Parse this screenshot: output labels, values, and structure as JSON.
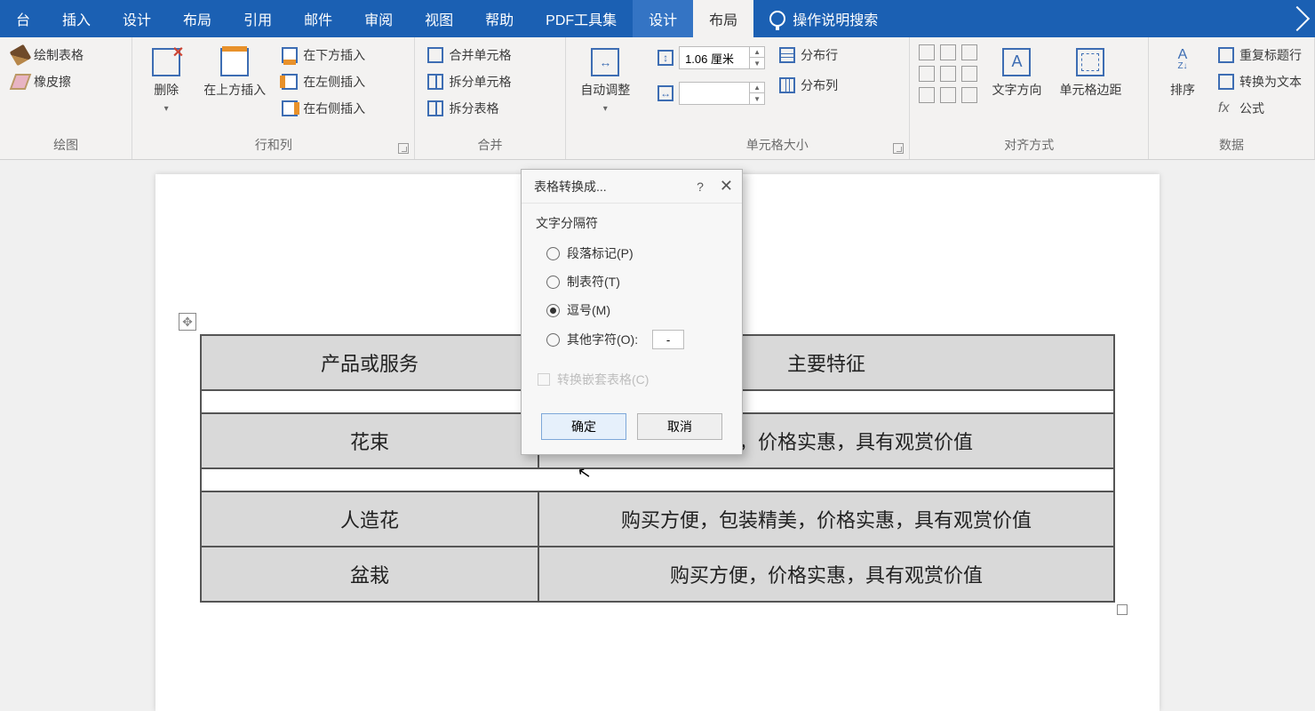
{
  "tabs": {
    "t0": "台",
    "t1": "插入",
    "t2": "设计",
    "t3": "布局",
    "t4": "引用",
    "t5": "邮件",
    "t6": "审阅",
    "t7": "视图",
    "t8": "帮助",
    "t9": "PDF工具集",
    "t10": "设计",
    "t11": "布局",
    "tellme": "操作说明搜索"
  },
  "ribbon": {
    "g_draw": {
      "label": "绘图",
      "draw_table": "绘制表格",
      "eraser": "橡皮擦"
    },
    "g_rows": {
      "label": "行和列",
      "delete": "删除",
      "insert_above": "在上方插入",
      "insert_below": "在下方插入",
      "insert_left": "在左侧插入",
      "insert_right": "在右侧插入"
    },
    "g_merge": {
      "label": "合并",
      "merge_cells": "合并单元格",
      "split_cells": "拆分单元格",
      "split_table": "拆分表格"
    },
    "g_size": {
      "label": "单元格大小",
      "autofit": "自动调整",
      "height_value": "1.06 厘米",
      "width_value": "",
      "dist_rows": "分布行",
      "dist_cols": "分布列"
    },
    "g_align": {
      "label": "对齐方式",
      "text_dir": "文字方向",
      "cell_margin": "单元格边距"
    },
    "g_data": {
      "label": "数据",
      "sort": "排序",
      "repeat_hdr": "重复标题行",
      "convert": "转换为文本",
      "formula": "公式"
    }
  },
  "doc_table": {
    "hdr_left": "产品或服务",
    "hdr_right": "主要特征",
    "r1_left": "花束",
    "r1_right": "装精美，价格实惠，具有观赏价值",
    "r2_left": "人造花",
    "r2_right": "购买方便，包装精美，价格实惠，具有观赏价值",
    "r3_left": "盆栽",
    "r3_right": "购买方便，价格实惠，具有观赏价值"
  },
  "dialog": {
    "title": "表格转换成...",
    "help": "?",
    "section": "文字分隔符",
    "opt_para": "段落标记(P)",
    "opt_tab": "制表符(T)",
    "opt_comma": "逗号(M)",
    "opt_other": "其他字符(O):",
    "other_value": "-",
    "nested": "转换嵌套表格(C)",
    "ok": "确定",
    "cancel": "取消",
    "selected": "comma"
  }
}
